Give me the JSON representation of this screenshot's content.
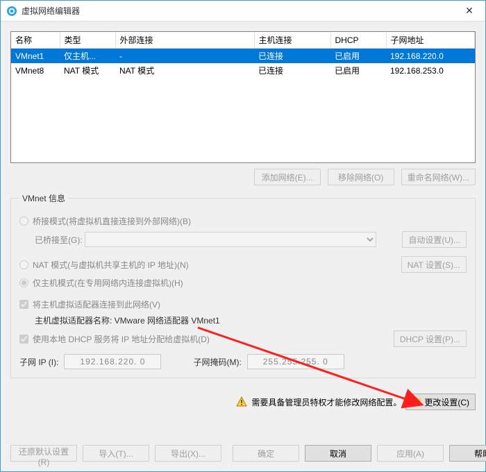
{
  "title": "虚拟网络编辑器",
  "columns": {
    "name": "名称",
    "type": "类型",
    "ext": "外部连接",
    "host": "主机连接",
    "dhcp": "DHCP",
    "subnet": "子网地址"
  },
  "rows": [
    {
      "name": "VMnet1",
      "type": "仅主机...",
      "ext": "-",
      "host": "已连接",
      "dhcp": "已启用",
      "subnet": "192.168.220.0",
      "selected": true
    },
    {
      "name": "VMnet8",
      "type": "NAT 模式",
      "ext": "NAT 模式",
      "host": "已连接",
      "dhcp": "已启用",
      "subnet": "192.168.253.0",
      "selected": false
    }
  ],
  "buttons": {
    "add": "添加网络(E)...",
    "remove": "移除网络(O)",
    "rename": "重命名网络(W)...",
    "autoset": "自动设置(U)...",
    "natset": "NAT 设置(S)...",
    "dhcpset": "DHCP 设置(P)...",
    "restore": "还原默认设置(R)",
    "import": "导入(T)...",
    "export": "导出(X)...",
    "ok": "确定",
    "cancel": "取消",
    "apply": "应用(A)",
    "help": "帮助",
    "change": "更改设置(C)"
  },
  "group": {
    "legend": "VMnet 信息",
    "bridged": "桥接模式(将虚拟机直接连接到外部网络)(B)",
    "bridged_to": "已桥接至(G):",
    "nat": "NAT 模式(与虚拟机共享主机的 IP 地址)(N)",
    "hostonly": "仅主机模式(在专用网络内连接虚拟机)(H)",
    "connect_host": "将主机虚拟适配器连接到此网络(V)",
    "host_adapter_label": "主机虚拟适配器名称: VMware 网络适配器 VMnet1",
    "use_dhcp": "使用本地 DHCP 服务将 IP 地址分配给虚拟机(D)"
  },
  "subnet": {
    "ip_label": "子网 IP (I):",
    "ip": "192.168.220. 0",
    "mask_label": "子网掩码(M):",
    "mask": "255.255.255. 0"
  },
  "warning": "需要具备管理员特权才能修改网络配置。"
}
